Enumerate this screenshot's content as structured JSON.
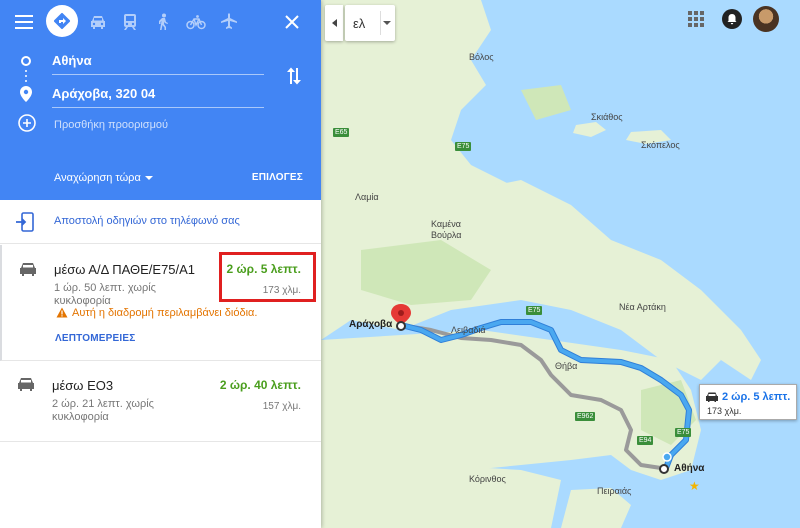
{
  "panel": {
    "origin": "Αθήνα",
    "destination": "Αράχοβα, 320 04",
    "add_destination": "Προσθήκη προορισμού",
    "depart": "Αναχώρηση τώρα",
    "options": "ΕΠΙΛΟΓΕΣ",
    "send_to_phone": "Αποστολή οδηγιών στο τηλέφωνό σας"
  },
  "routes": [
    {
      "via": "μέσω Α/Δ ΠΑΘΕ/Ε75/Α1",
      "time": "2 ώρ. 5 λεπτ.",
      "traffic": "1 ώρ. 50 λεπτ. χωρίς κυκλοφορία",
      "distance": "173 χλμ.",
      "toll_warning": "Αυτή η διαδρομή περιλαμβάνει διόδια.",
      "details": "ΛΕΠΤΟΜΕΡΕΙΕΣ"
    },
    {
      "via": "μέσω ΕΟ3",
      "time": "2 ώρ. 40 λεπτ.",
      "traffic": "2 ώρ. 21 λεπτ. χωρίς κυκλοφορία",
      "distance": "157 χλμ."
    }
  ],
  "map": {
    "language": "ελ",
    "callout": {
      "time": "2 ώρ. 5 λεπτ.",
      "distance": "173 χλμ."
    },
    "labels": {
      "volos": "Βόλος",
      "skiathos": "Σκιάθος",
      "skopelos": "Σκόπελος",
      "lamia": "Λαμία",
      "kamena_vourla": "Καμένα\nΒούρλα",
      "nea_artaki": "Νέα Αρτάκη",
      "arachova": "Αράχοβα",
      "livadeia": "Λειβαδιά",
      "thiva": "Θήβα",
      "korinthos": "Κόρινθος",
      "peiraias": "Πειραιάς",
      "athina": "Αθήνα"
    },
    "shields": [
      "E65",
      "E75",
      "E75",
      "E962",
      "E94",
      "E75"
    ]
  },
  "colors": {
    "header": "#4285f4",
    "route_active": "#4aa8f0",
    "route_alt": "#9a9a9a",
    "time_green": "#4a9e1d",
    "highlight": "#e02020"
  }
}
